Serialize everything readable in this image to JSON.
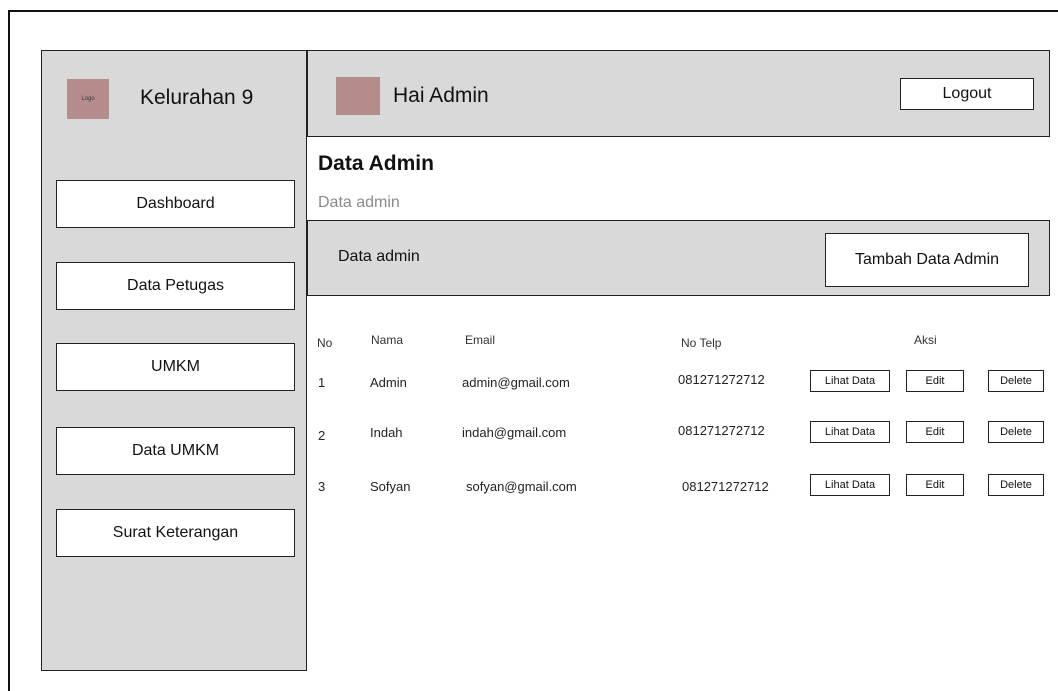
{
  "sidebar": {
    "logo_text": "Logo",
    "brand": "Kelurahan 9",
    "items": [
      {
        "label": "Dashboard"
      },
      {
        "label": "Data Petugas"
      },
      {
        "label": "UMKM"
      },
      {
        "label": "Data UMKM"
      },
      {
        "label": "Surat Keterangan"
      }
    ]
  },
  "header": {
    "greeting": "Hai Admin",
    "logout_label": "Logout"
  },
  "page": {
    "title": "Data Admin",
    "subtitle": "Data admin"
  },
  "panel": {
    "label": "Data admin",
    "add_button": "Tambah Data Admin"
  },
  "table": {
    "headers": {
      "no": "No",
      "nama": "Nama",
      "email": "Email",
      "telp": "No Telp",
      "aksi": "Aksi"
    },
    "actions": {
      "view": "Lihat Data",
      "edit": "Edit",
      "delete": "Delete"
    },
    "rows": [
      {
        "no": "1",
        "nama": "Admin",
        "email": "admin@gmail.com",
        "telp": "081271272712"
      },
      {
        "no": "2",
        "nama": "Indah",
        "email": "indah@gmail.com",
        "telp": "081271272712"
      },
      {
        "no": "3",
        "nama": "Sofyan",
        "email": "sofyan@gmail.com",
        "telp": "081271272712"
      }
    ]
  },
  "colors": {
    "panel_bg": "#d9d9d9",
    "placeholder_img": "#b48c8c",
    "subtitle": "#8a8a8a"
  }
}
